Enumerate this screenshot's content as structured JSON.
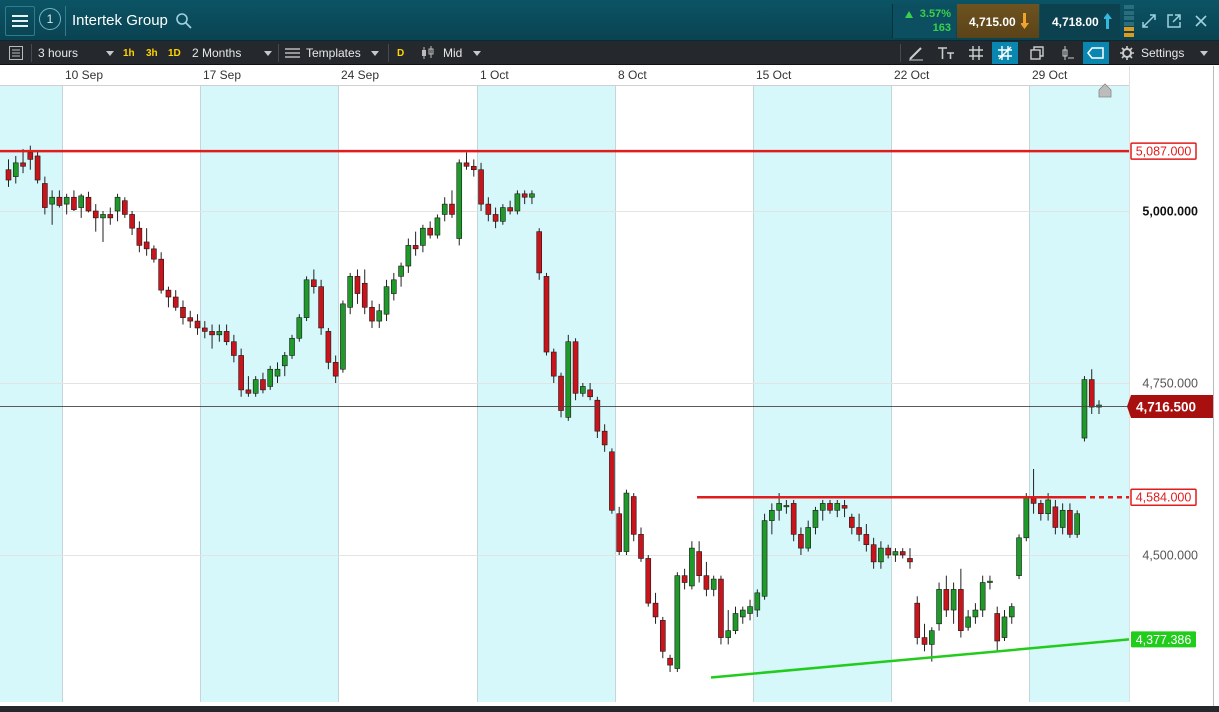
{
  "header": {
    "window_number": "1",
    "instrument": "Intertek Group",
    "change_pct": "3.57%",
    "change_abs": "163",
    "sell_price": "4,715.00",
    "buy_price": "4,718.00"
  },
  "toolbar": {
    "timeframe": "3 hours",
    "quick_intervals": [
      "1h",
      "3h",
      "1D"
    ],
    "range": "2 Months",
    "templates": "Templates",
    "price_type_badge": "D",
    "price_type": "Mid",
    "settings": "Settings"
  },
  "colors": {
    "up": "#1f9a2a",
    "down": "#c9141c",
    "resistance": "#e01c1c",
    "support": "#22cc1c",
    "band": "#d6f8fb",
    "current": "#a80f0f"
  },
  "chart_data": {
    "type": "candlestick",
    "x_labels": [
      "10 Sep",
      "17 Sep",
      "24 Sep",
      "1 Oct",
      "8 Oct",
      "15 Oct",
      "22 Oct",
      "29 Oct"
    ],
    "y_ticks": [
      "5,000.000",
      "4,750.000",
      "4,500.000"
    ],
    "y_range": [
      4320,
      5200
    ],
    "current_price": "4,716.500",
    "horizontal_lines": [
      {
        "label": "5,087.000",
        "value": 5087,
        "color": "#e01c1c",
        "scope": "full"
      },
      {
        "label": "4,584.000",
        "value": 4584,
        "color": "#e01c1c",
        "scope": "partial"
      }
    ],
    "trend_lines": [
      {
        "label": "4,377.386",
        "color": "#22cc1c",
        "from_value": 4322,
        "to_value": 4377.386
      }
    ],
    "candles": [
      [
        5060,
        5075,
        5035,
        5045
      ],
      [
        5050,
        5080,
        5040,
        5070
      ],
      [
        5070,
        5090,
        5055,
        5065
      ],
      [
        5085,
        5095,
        5060,
        5075
      ],
      [
        5080,
        5088,
        5040,
        5045
      ],
      [
        5040,
        5050,
        4995,
        5005
      ],
      [
        5010,
        5030,
        4980,
        5020
      ],
      [
        5020,
        5030,
        5005,
        5008
      ],
      [
        5010,
        5025,
        4995,
        5020
      ],
      [
        5020,
        5030,
        5000,
        5002
      ],
      [
        5005,
        5025,
        4990,
        5022
      ],
      [
        5020,
        5028,
        4998,
        5000
      ],
      [
        5000,
        5010,
        4970,
        4990
      ],
      [
        4990,
        5000,
        4955,
        4995
      ],
      [
        4995,
        5005,
        4980,
        4990
      ],
      [
        5000,
        5025,
        4985,
        5020
      ],
      [
        5015,
        5020,
        4990,
        4995
      ],
      [
        4995,
        5000,
        4965,
        4975
      ],
      [
        4975,
        4985,
        4940,
        4950
      ],
      [
        4955,
        4975,
        4935,
        4945
      ],
      [
        4945,
        4950,
        4925,
        4930
      ],
      [
        4930,
        4940,
        4880,
        4885
      ],
      [
        4885,
        4890,
        4860,
        4875
      ],
      [
        4875,
        4885,
        4855,
        4860
      ],
      [
        4860,
        4870,
        4835,
        4845
      ],
      [
        4845,
        4855,
        4830,
        4840
      ],
      [
        4840,
        4850,
        4820,
        4830
      ],
      [
        4830,
        4840,
        4815,
        4825
      ],
      [
        4825,
        4835,
        4800,
        4820
      ],
      [
        4820,
        4835,
        4810,
        4825
      ],
      [
        4825,
        4835,
        4805,
        4810
      ],
      [
        4810,
        4820,
        4780,
        4790
      ],
      [
        4790,
        4800,
        4730,
        4740
      ],
      [
        4740,
        4760,
        4730,
        4735
      ],
      [
        4735,
        4760,
        4730,
        4755
      ],
      [
        4755,
        4765,
        4735,
        4740
      ],
      [
        4745,
        4775,
        4740,
        4770
      ],
      [
        4760,
        4780,
        4750,
        4770
      ],
      [
        4775,
        4795,
        4760,
        4790
      ],
      [
        4790,
        4820,
        4785,
        4815
      ],
      [
        4815,
        4850,
        4810,
        4845
      ],
      [
        4845,
        4905,
        4840,
        4900
      ],
      [
        4900,
        4915,
        4880,
        4890
      ],
      [
        4890,
        4900,
        4820,
        4830
      ],
      [
        4825,
        4830,
        4770,
        4780
      ],
      [
        4780,
        4790,
        4750,
        4760
      ],
      [
        4770,
        4870,
        4765,
        4865
      ],
      [
        4860,
        4910,
        4850,
        4905
      ],
      [
        4905,
        4915,
        4865,
        4880
      ],
      [
        4895,
        4915,
        4850,
        4860
      ],
      [
        4860,
        4870,
        4830,
        4840
      ],
      [
        4840,
        4865,
        4830,
        4855
      ],
      [
        4850,
        4900,
        4840,
        4890
      ],
      [
        4880,
        4910,
        4870,
        4900
      ],
      [
        4905,
        4925,
        4890,
        4920
      ],
      [
        4920,
        4960,
        4910,
        4950
      ],
      [
        4950,
        4970,
        4935,
        4945
      ],
      [
        4950,
        4980,
        4940,
        4975
      ],
      [
        4975,
        4985,
        4960,
        4965
      ],
      [
        4965,
        4995,
        4960,
        4990
      ],
      [
        4995,
        5020,
        4985,
        5010
      ],
      [
        5010,
        5030,
        4990,
        4995
      ],
      [
        4960,
        5075,
        4950,
        5070
      ],
      [
        5070,
        5085,
        5060,
        5065
      ],
      [
        5065,
        5075,
        5050,
        5060
      ],
      [
        5060,
        5070,
        5000,
        5010
      ],
      [
        5010,
        5020,
        4985,
        4995
      ],
      [
        4995,
        5005,
        4975,
        4985
      ],
      [
        4985,
        5010,
        4980,
        5005
      ],
      [
        5005,
        5015,
        4995,
        5000
      ],
      [
        5000,
        5030,
        4995,
        5025
      ],
      [
        5025,
        5030,
        5010,
        5020
      ],
      [
        5020,
        5030,
        5010,
        5025
      ],
      [
        4970,
        4975,
        4900,
        4910
      ],
      [
        4905,
        4910,
        4790,
        4795
      ],
      [
        4795,
        4800,
        4750,
        4760
      ],
      [
        4760,
        4765,
        4700,
        4710
      ],
      [
        4700,
        4820,
        4695,
        4810
      ],
      [
        4810,
        4815,
        4725,
        4735
      ],
      [
        4735,
        4750,
        4730,
        4745
      ],
      [
        4740,
        4750,
        4725,
        4730
      ],
      [
        4725,
        4730,
        4670,
        4680
      ],
      [
        4680,
        4690,
        4650,
        4660
      ],
      [
        4650,
        4655,
        4560,
        4565
      ],
      [
        4560,
        4570,
        4500,
        4505
      ],
      [
        4505,
        4595,
        4500,
        4590
      ],
      [
        4585,
        4590,
        4520,
        4530
      ],
      [
        4530,
        4540,
        4490,
        4495
      ],
      [
        4495,
        4500,
        4425,
        4430
      ],
      [
        4430,
        4445,
        4400,
        4410
      ],
      [
        4405,
        4410,
        4350,
        4360
      ],
      [
        4350,
        4355,
        4330,
        4340
      ],
      [
        4335,
        4475,
        4330,
        4470
      ],
      [
        4470,
        4480,
        4450,
        4460
      ],
      [
        4455,
        4520,
        4450,
        4510
      ],
      [
        4505,
        4520,
        4460,
        4470
      ],
      [
        4470,
        4490,
        4440,
        4450
      ],
      [
        4450,
        4470,
        4440,
        4465
      ],
      [
        4465,
        4470,
        4370,
        4380
      ],
      [
        4380,
        4420,
        4370,
        4390
      ],
      [
        4390,
        4425,
        4385,
        4415
      ],
      [
        4410,
        4425,
        4400,
        4420
      ],
      [
        4415,
        4435,
        4405,
        4425
      ],
      [
        4420,
        4450,
        4410,
        4445
      ],
      [
        4440,
        4560,
        4435,
        4550
      ],
      [
        4550,
        4575,
        4530,
        4565
      ],
      [
        4565,
        4590,
        4550,
        4575
      ],
      [
        4570,
        4580,
        4560,
        4572
      ],
      [
        4575,
        4580,
        4520,
        4530
      ],
      [
        4530,
        4540,
        4500,
        4510
      ],
      [
        4510,
        4550,
        4505,
        4540
      ],
      [
        4540,
        4570,
        4530,
        4565
      ],
      [
        4565,
        4580,
        4550,
        4575
      ],
      [
        4575,
        4580,
        4560,
        4565
      ],
      [
        4565,
        4580,
        4555,
        4575
      ],
      [
        4572,
        4580,
        4555,
        4568
      ],
      [
        4555,
        4560,
        4530,
        4540
      ],
      [
        4540,
        4560,
        4520,
        4530
      ],
      [
        4530,
        4545,
        4505,
        4515
      ],
      [
        4515,
        4525,
        4480,
        4490
      ],
      [
        4490,
        4520,
        4480,
        4510
      ],
      [
        4510,
        4515,
        4495,
        4500
      ],
      [
        4500,
        4510,
        4490,
        4505
      ],
      [
        4505,
        4510,
        4495,
        4500
      ],
      [
        4495,
        4510,
        4480,
        4490
      ],
      [
        4430,
        4440,
        4370,
        4380
      ],
      [
        4380,
        4400,
        4360,
        4370
      ],
      [
        4370,
        4395,
        4345,
        4390
      ],
      [
        4400,
        4460,
        4390,
        4450
      ],
      [
        4450,
        4470,
        4410,
        4420
      ],
      [
        4420,
        4460,
        4400,
        4450
      ],
      [
        4450,
        4480,
        4380,
        4390
      ],
      [
        4395,
        4420,
        4390,
        4410
      ],
      [
        4410,
        4430,
        4400,
        4420
      ],
      [
        4420,
        4470,
        4410,
        4460
      ],
      [
        4460,
        4470,
        4450,
        4462
      ],
      [
        4415,
        4425,
        4360,
        4375
      ],
      [
        4380,
        4420,
        4375,
        4410
      ],
      [
        4410,
        4430,
        4400,
        4425
      ],
      [
        4470,
        4530,
        4465,
        4525
      ],
      [
        4525,
        4590,
        4520,
        4585
      ],
      [
        4585,
        4625,
        4560,
        4575
      ],
      [
        4575,
        4580,
        4550,
        4560
      ],
      [
        4560,
        4590,
        4550,
        4580
      ],
      [
        4570,
        4580,
        4530,
        4540
      ],
      [
        4540,
        4575,
        4530,
        4565
      ],
      [
        4565,
        4575,
        4525,
        4530
      ],
      [
        4530,
        4565,
        4525,
        4560
      ],
      [
        4670,
        4760,
        4665,
        4755
      ],
      [
        4755,
        4770,
        4705,
        4715
      ],
      [
        4715,
        4725,
        4705,
        4718
      ]
    ]
  }
}
